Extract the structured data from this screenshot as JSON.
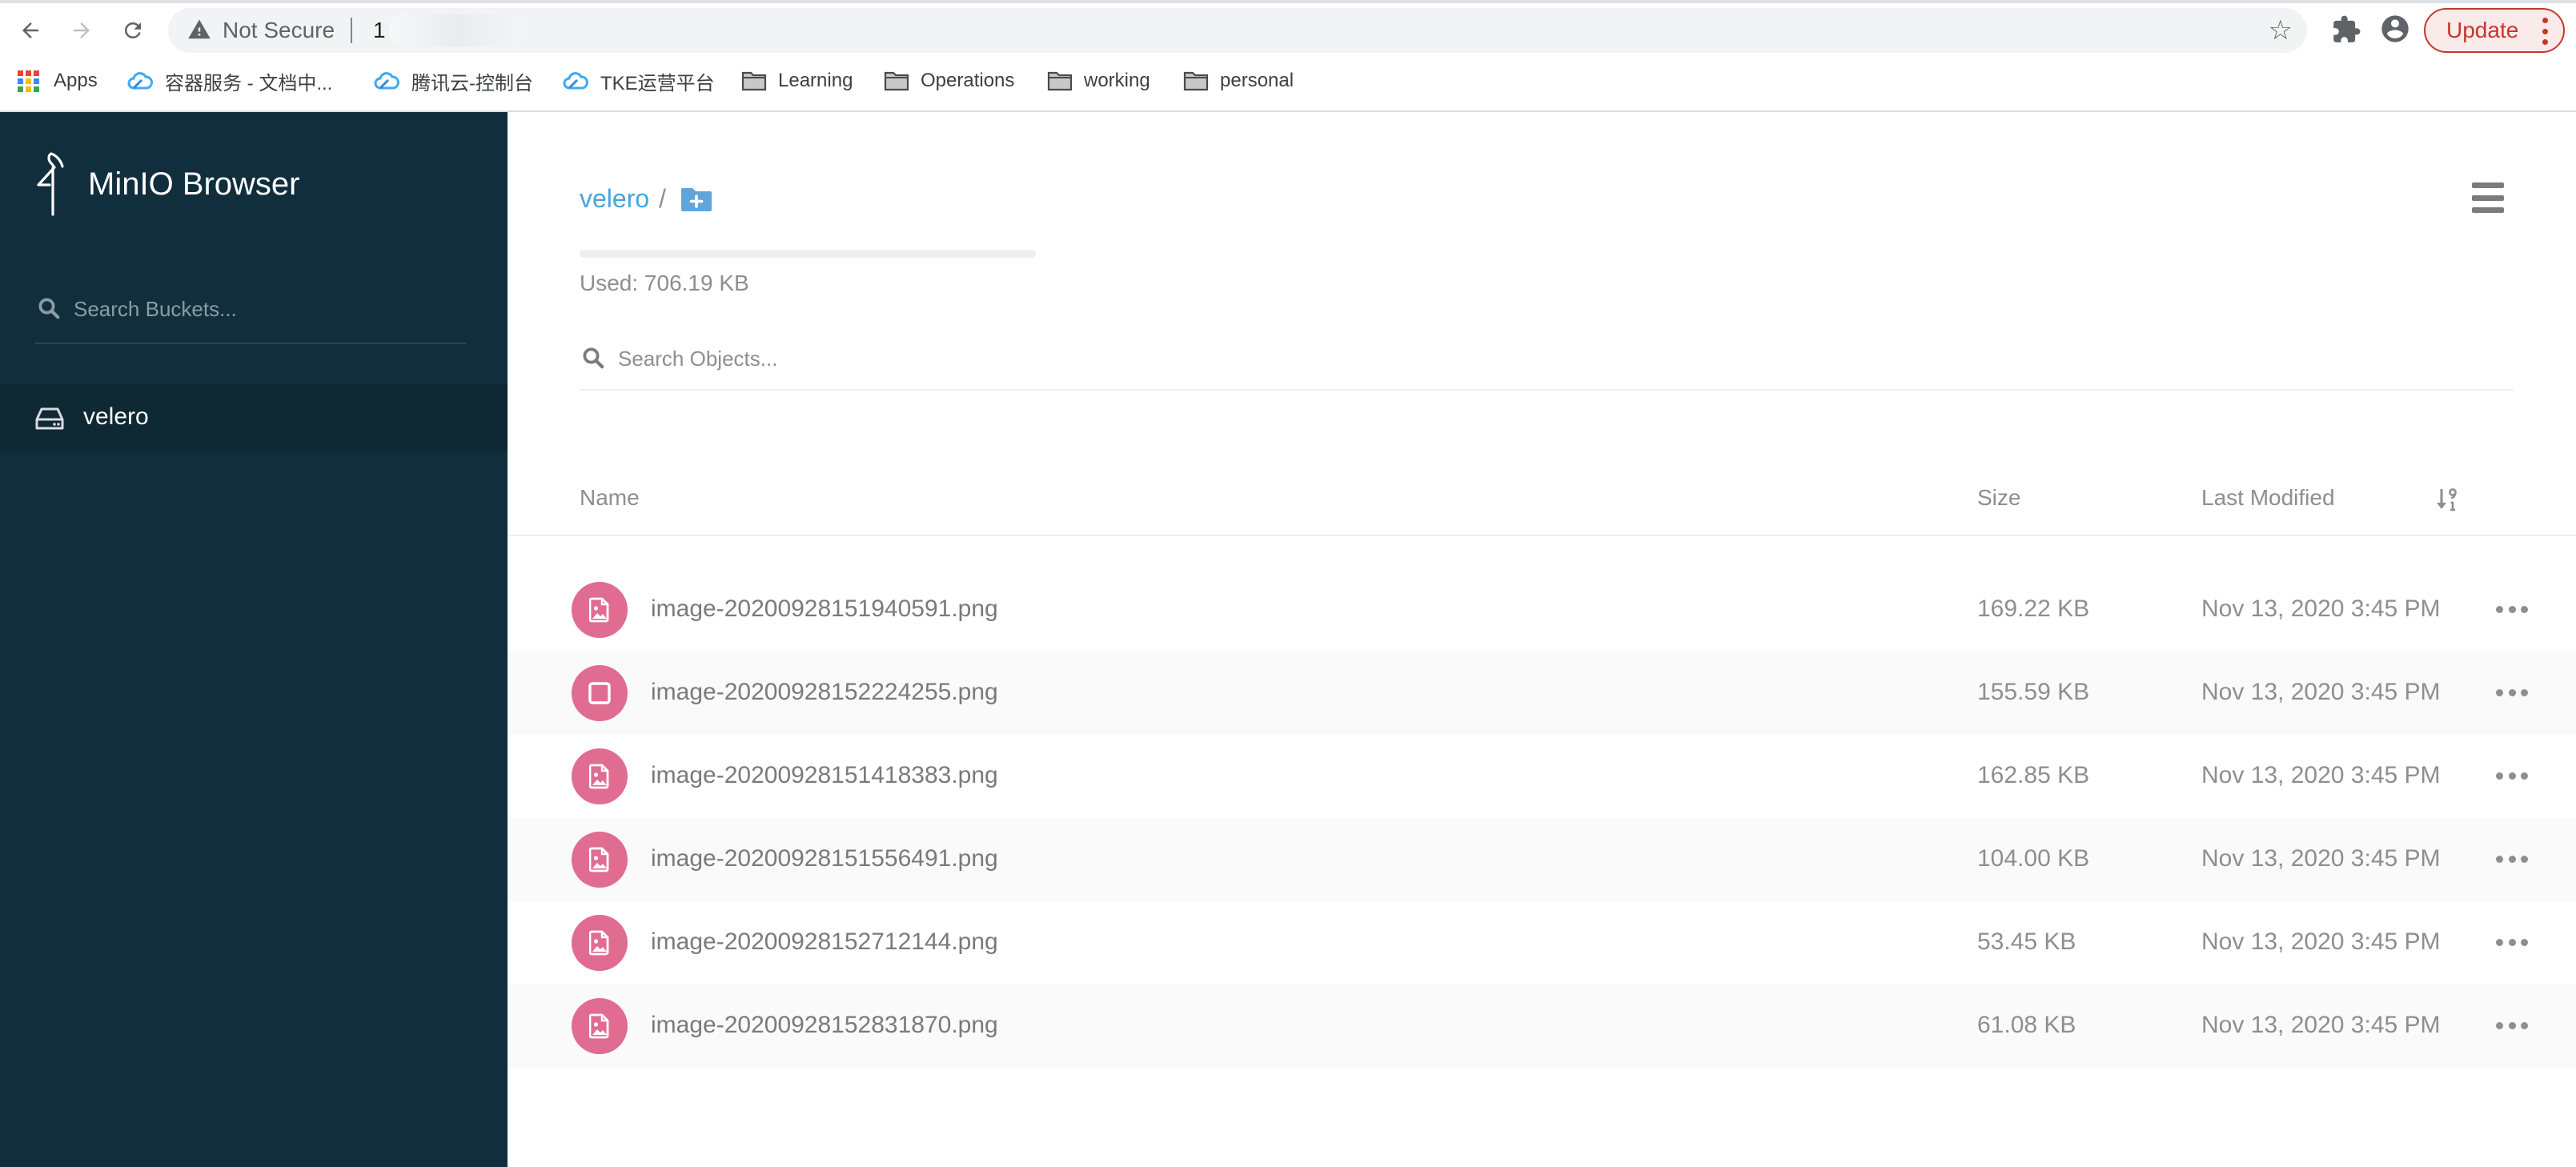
{
  "browser": {
    "security_label": "Not Secure",
    "url_visible": "1",
    "update_label": "Update",
    "bookmarks": [
      {
        "label": "Apps",
        "icon": "apps-grid-icon"
      },
      {
        "label": "容器服务 - 文档中...",
        "icon": "tencent-cloud-icon"
      },
      {
        "label": "腾讯云-控制台",
        "icon": "tencent-cloud-icon"
      },
      {
        "label": "TKE运营平台",
        "icon": "tencent-cloud-icon"
      },
      {
        "label": "Learning",
        "icon": "folder-icon"
      },
      {
        "label": "Operations",
        "icon": "folder-icon"
      },
      {
        "label": "working",
        "icon": "folder-icon"
      },
      {
        "label": "personal",
        "icon": "folder-icon"
      }
    ]
  },
  "sidebar": {
    "brand": "MinIO Browser",
    "search_placeholder": "Search Buckets...",
    "buckets": [
      {
        "label": "velero",
        "active": true
      }
    ]
  },
  "main": {
    "breadcrumb": [
      {
        "label": "velero"
      }
    ],
    "breadcrumb_separator": "/",
    "usage_fraction": 0.0,
    "usage_text": "Used: 706.19 KB",
    "search_placeholder": "Search Objects...",
    "columns": {
      "name": "Name",
      "size": "Size",
      "last_modified": "Last Modified"
    },
    "objects": [
      {
        "name": "image-20200928151940591.png",
        "size": "169.22 KB",
        "modified": "Nov 13, 2020 3:45 PM",
        "icon": "image-file-icon"
      },
      {
        "name": "image-20200928152224255.png",
        "size": "155.59 KB",
        "modified": "Nov 13, 2020 3:45 PM",
        "icon": "checkbox-icon"
      },
      {
        "name": "image-20200928151418383.png",
        "size": "162.85 KB",
        "modified": "Nov 13, 2020 3:45 PM",
        "icon": "image-file-icon"
      },
      {
        "name": "image-20200928151556491.png",
        "size": "104.00 KB",
        "modified": "Nov 13, 2020 3:45 PM",
        "icon": "image-file-icon"
      },
      {
        "name": "image-20200928152712144.png",
        "size": "53.45 KB",
        "modified": "Nov 13, 2020 3:45 PM",
        "icon": "image-file-icon"
      },
      {
        "name": "image-20200928152831870.png",
        "size": "61.08 KB",
        "modified": "Nov 13, 2020 3:45 PM",
        "icon": "image-file-icon"
      }
    ]
  },
  "colors": {
    "sidebar_bg": "#112e3d",
    "sidebar_active_bg": "#0e2834",
    "accent_blue": "#46a5e0",
    "file_icon_pink": "#e06c92",
    "update_red": "#c5372c"
  }
}
